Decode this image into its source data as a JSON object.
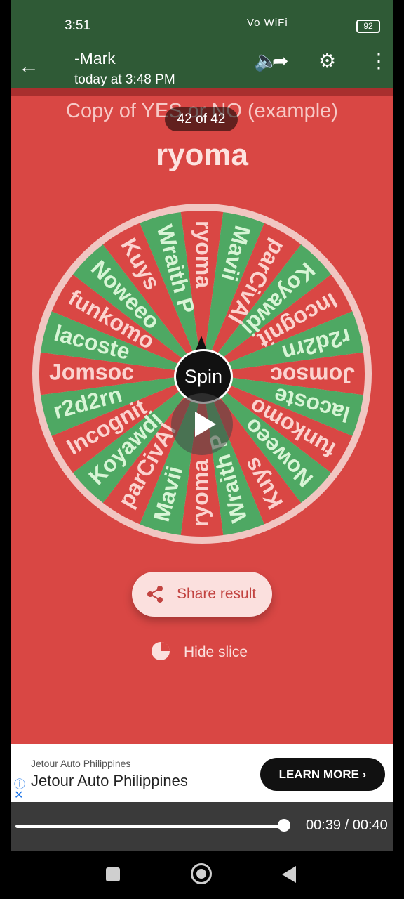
{
  "status": {
    "time": "3:51",
    "icons": "Vo WiFi",
    "battery": "92"
  },
  "header": {
    "sender": "-Mark",
    "timestamp": "today at 3:48 PM"
  },
  "app": {
    "title": "Copy of YES or NO (example)",
    "counter": "42 of 42",
    "result": "ryoma"
  },
  "wheel": {
    "spin_label": "Spin",
    "colors": {
      "red": "#d94744",
      "green": "#4ea863",
      "text_on_red": "#fbd3cf",
      "text_on_green": "#d8f5d6"
    },
    "slices": [
      "ryoma",
      "Mavii",
      "parCivAl",
      "Koyawdi",
      "Incognit",
      "r2d2rn",
      "Jomsoc",
      "lacoste",
      "funkomo",
      "Noweeo",
      "Kuys",
      "Wraith P",
      "ryoma",
      "Mavii",
      "parCivAl",
      "Koyawdi",
      "Incognit",
      "r2d2rn",
      "Jomsoc",
      "lacoste",
      "funkomo",
      "Noweeo",
      "Kuys",
      "Wraith P"
    ]
  },
  "buttons": {
    "share": "Share result",
    "hide": "Hide slice"
  },
  "ad": {
    "advertiser": "Jetour Auto Philippines",
    "headline": "Jetour Auto Philippines",
    "cta": "LEARN MORE ›"
  },
  "video": {
    "time": "00:39 / 00:40",
    "progress": 0.975
  }
}
